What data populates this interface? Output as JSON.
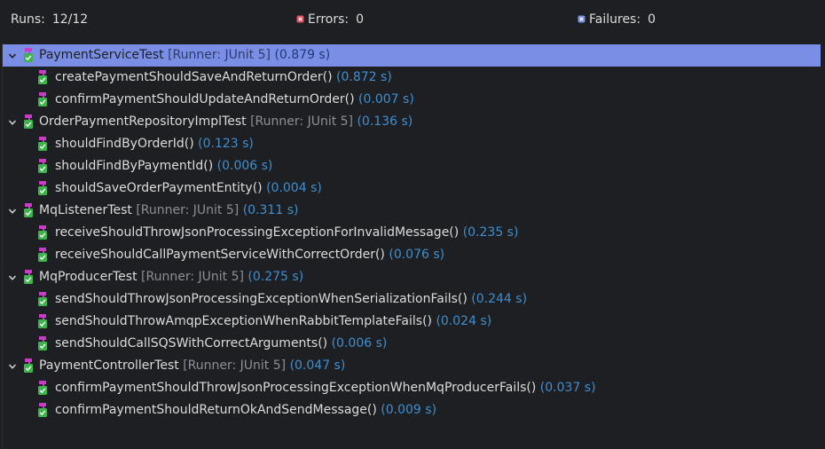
{
  "stats": {
    "runs_label": "Runs:",
    "runs_value": "12/12",
    "errors_label": "Errors:",
    "errors_value": "0",
    "failures_label": "Failures:",
    "failures_value": "0"
  },
  "tree": [
    {
      "name": "PaymentServiceTest",
      "runner": "[Runner: JUnit 5]",
      "time": "(0.879 s)",
      "selected": true,
      "tests": [
        {
          "name": "createPaymentShouldSaveAndReturnOrder()",
          "time": "(0.872 s)"
        },
        {
          "name": "confirmPaymentShouldUpdateAndReturnOrder()",
          "time": "(0.007 s)"
        }
      ]
    },
    {
      "name": "OrderPaymentRepositoryImplTest",
      "runner": "[Runner: JUnit 5]",
      "time": "(0.136 s)",
      "selected": false,
      "tests": [
        {
          "name": "shouldFindByOrderId()",
          "time": "(0.123 s)"
        },
        {
          "name": "shouldFindByPaymentId()",
          "time": "(0.006 s)"
        },
        {
          "name": "shouldSaveOrderPaymentEntity()",
          "time": "(0.004 s)"
        }
      ]
    },
    {
      "name": "MqListenerTest",
      "runner": "[Runner: JUnit 5]",
      "time": "(0.311 s)",
      "selected": false,
      "tests": [
        {
          "name": "receiveShouldThrowJsonProcessingExceptionForInvalidMessage()",
          "time": "(0.235 s)"
        },
        {
          "name": "receiveShouldCallPaymentServiceWithCorrectOrder()",
          "time": "(0.076 s)"
        }
      ]
    },
    {
      "name": "MqProducerTest",
      "runner": "[Runner: JUnit 5]",
      "time": "(0.275 s)",
      "selected": false,
      "tests": [
        {
          "name": "sendShouldThrowJsonProcessingExceptionWhenSerializationFails()",
          "time": "(0.244 s)"
        },
        {
          "name": "sendShouldThrowAmqpExceptionWhenRabbitTemplateFails()",
          "time": "(0.024 s)"
        },
        {
          "name": "sendShouldCallSQSWithCorrectArguments()",
          "time": "(0.006 s)"
        }
      ]
    },
    {
      "name": "PaymentControllerTest",
      "runner": "[Runner: JUnit 5]",
      "time": "(0.047 s)",
      "selected": false,
      "tests": [
        {
          "name": "confirmPaymentShouldThrowJsonProcessingExceptionWhenMqProducerFails()",
          "time": "(0.037 s)"
        },
        {
          "name": "confirmPaymentShouldReturnOkAndSendMessage()",
          "time": "(0.009 s)"
        }
      ]
    }
  ],
  "icons": {
    "expand": "chevron-down-icon",
    "suite": "test-suite-passed-icon",
    "test": "test-case-passed-icon",
    "error": "error-icon",
    "failure": "failure-icon"
  },
  "colors": {
    "selection": "#7a8ee6",
    "time": "#3f8fd0",
    "runner": "#8c8f96",
    "error_marker": "#e05561",
    "failure_marker": "#7a8ee6",
    "icon_magenta": "#c83cc8",
    "icon_green": "#3cb44b"
  }
}
